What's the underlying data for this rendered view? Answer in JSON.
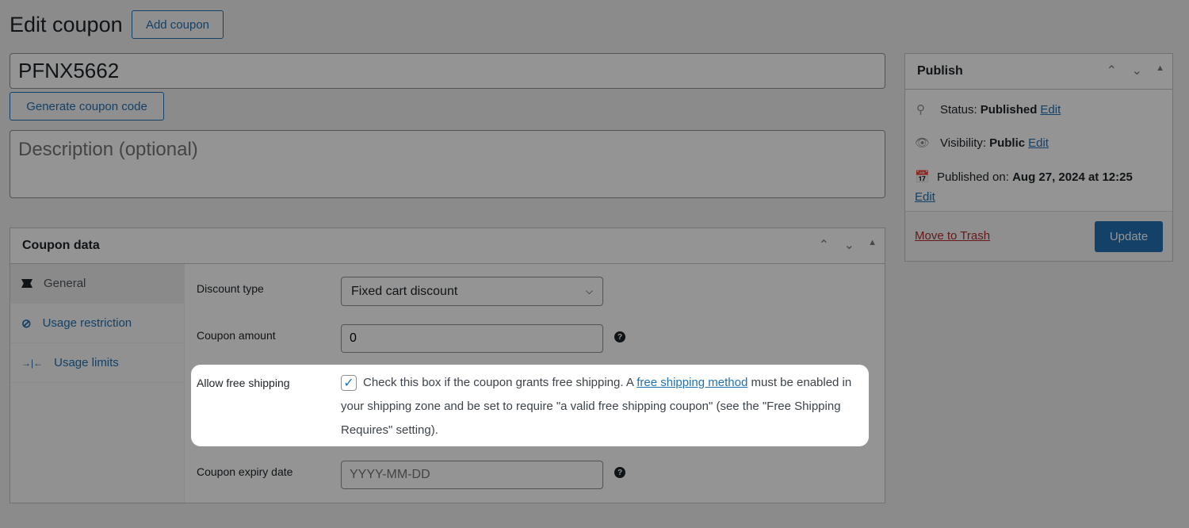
{
  "header": {
    "title": "Edit coupon",
    "add_button": "Add coupon"
  },
  "coupon_code": {
    "value": "PFNX5662"
  },
  "generate_button": "Generate coupon code",
  "description": {
    "placeholder": "Description (optional)",
    "value": ""
  },
  "coupon_data": {
    "title": "Coupon data",
    "tabs": [
      {
        "label": "General",
        "icon": "ticket-icon",
        "active": true
      },
      {
        "label": "Usage restriction",
        "icon": "block-icon",
        "active": false
      },
      {
        "label": "Usage limits",
        "icon": "limits-icon",
        "active": false
      }
    ],
    "fields": {
      "discount_type": {
        "label": "Discount type",
        "value": "Fixed cart discount"
      },
      "coupon_amount": {
        "label": "Coupon amount",
        "value": "0"
      },
      "free_shipping": {
        "label": "Allow free shipping",
        "checked": true,
        "text_before": "Check this box if the coupon grants free shipping. A ",
        "link": "free shipping method",
        "text_after": " must be enabled in your shipping zone and be set to require \"a valid free shipping coupon\" (see the \"Free Shipping Requires\" setting)."
      },
      "expiry_date": {
        "label": "Coupon expiry date",
        "placeholder": "YYYY-MM-DD",
        "value": ""
      }
    }
  },
  "publish": {
    "title": "Publish",
    "status_label": "Status:",
    "status_value": "Published",
    "visibility_label": "Visibility:",
    "visibility_value": "Public",
    "published_label": "Published on:",
    "published_value": "Aug 27, 2024 at 12:25",
    "edit": "Edit",
    "trash": "Move to Trash",
    "update": "Update"
  },
  "colors": {
    "accent": "#2271b1",
    "primary_button": "#2271b1",
    "trash": "#b32d2e"
  }
}
